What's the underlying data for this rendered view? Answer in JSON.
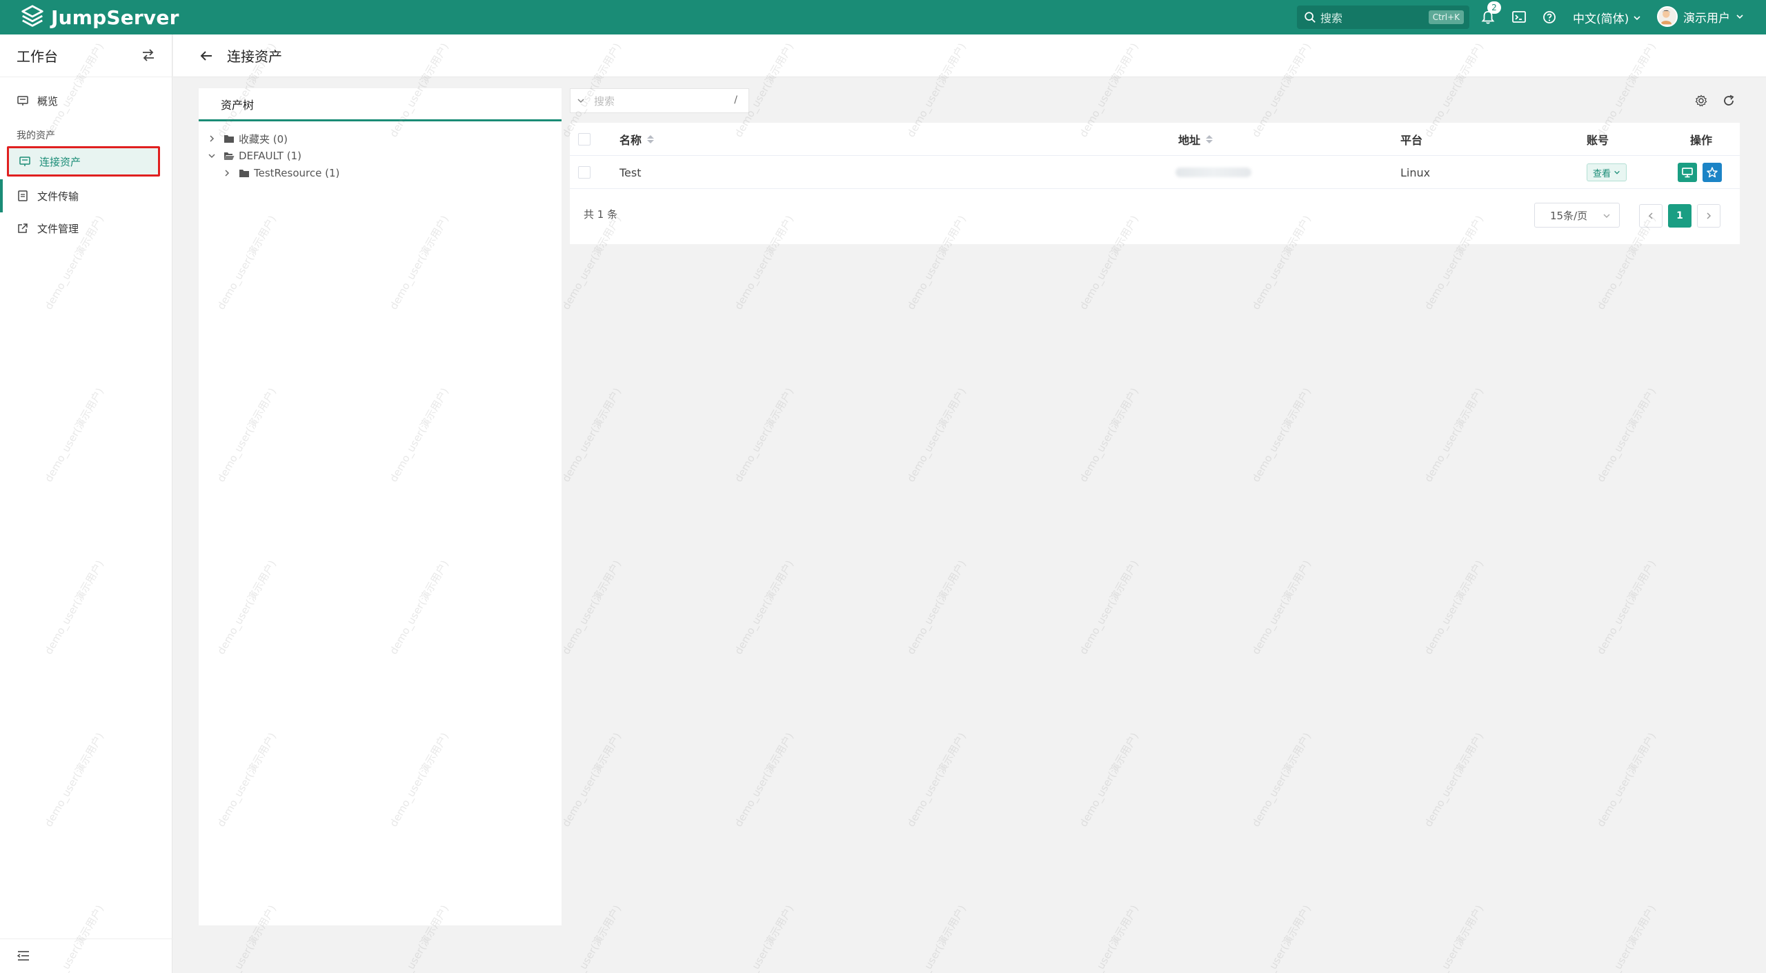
{
  "topbar": {
    "brand": "JumpServer",
    "search_placeholder": "搜索",
    "search_shortcut": "Ctrl+K",
    "notification_count": "2",
    "language": "中文(简体)",
    "user_name": "演示用户"
  },
  "sidebar": {
    "title": "工作台",
    "items": [
      {
        "label": "概览",
        "icon": "overview-icon"
      },
      {
        "label": "连接资产",
        "icon": "monitor-icon",
        "active": true
      },
      {
        "label": "文件传输",
        "icon": "file-transfer-icon"
      },
      {
        "label": "文件管理",
        "icon": "external-link-icon"
      }
    ],
    "group_label": "我的资产"
  },
  "page": {
    "title": "连接资产"
  },
  "tree": {
    "tab_label": "资产树",
    "nodes": [
      {
        "label": "收藏夹 (0)",
        "expanded": false,
        "level": 0
      },
      {
        "label": "DEFAULT (1)",
        "expanded": true,
        "level": 0
      },
      {
        "label": "TestResource (1)",
        "expanded": false,
        "level": 1
      }
    ]
  },
  "search": {
    "placeholder": "搜索",
    "shortcut": "/"
  },
  "table": {
    "columns": {
      "name": "名称",
      "address": "地址",
      "platform": "平台",
      "account": "账号",
      "actions": "操作"
    },
    "rows": [
      {
        "name": "Test",
        "platform": "Linux",
        "account_button": "查看"
      }
    ]
  },
  "pagination": {
    "total": "共 1 条",
    "page_size": "15条/页",
    "current_page": "1"
  },
  "watermark": "demo_user(演示用户)",
  "colors": {
    "brand": "#1a8c76",
    "primary_button": "#1a9e83",
    "favorite_button": "#1c84c6",
    "highlight_border": "#e02020"
  }
}
